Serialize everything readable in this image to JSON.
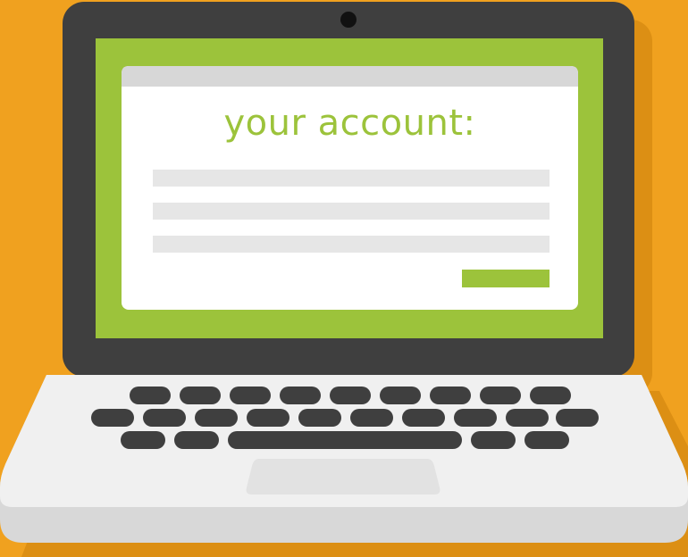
{
  "form": {
    "heading": "your account:",
    "fields": [
      {
        "value": ""
      },
      {
        "value": ""
      },
      {
        "value": ""
      }
    ],
    "submit_label": ""
  },
  "colors": {
    "background": "#f0a11f",
    "bezel": "#3f3f3f",
    "screen": "#9cc33b",
    "window": "#ffffff",
    "titlebar": "#d7d7d7",
    "field": "#e6e6e6",
    "accent": "#9cc33b",
    "keyboard_deck": "#f0f0f0",
    "keys": "#3f3f3f",
    "touchpad": "#e2e2e2"
  },
  "icons": [
    "webcam-icon"
  ]
}
